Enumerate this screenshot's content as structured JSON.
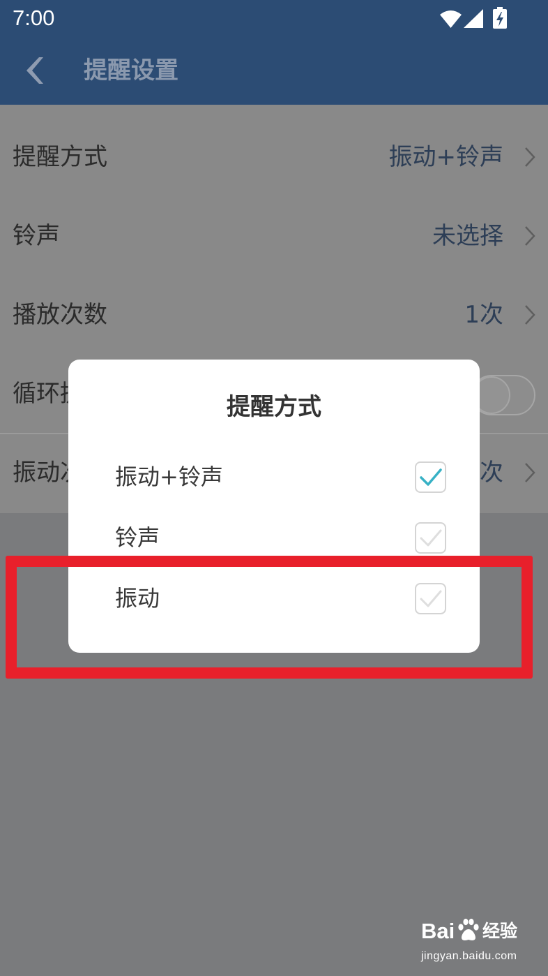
{
  "status_bar": {
    "time": "7:00",
    "icons": [
      "wifi-icon",
      "signal-icon",
      "battery-charging-icon"
    ]
  },
  "app_bar": {
    "back_icon": "back-chevron-icon",
    "title": "提醒设置"
  },
  "settings": {
    "rows": [
      {
        "label": "提醒方式",
        "value": "振动+铃声",
        "icon": "chevron-right-icon"
      },
      {
        "label": "铃声",
        "value": "未选择",
        "icon": "chevron-right-icon"
      },
      {
        "label": "播放次数",
        "value": "1次",
        "icon": "chevron-right-icon"
      },
      {
        "label": "循环提",
        "toggle_on": false
      },
      {
        "label": "振动次",
        "value": "次",
        "icon": "chevron-right-icon"
      }
    ]
  },
  "dialog": {
    "title": "提醒方式",
    "options": [
      {
        "label": "振动+铃声",
        "checked": true
      },
      {
        "label": "铃声",
        "checked": false
      },
      {
        "label": "振动",
        "checked": false
      }
    ],
    "check_icon": "checkmark-icon"
  },
  "watermark": {
    "brand_latin": "Bai",
    "brand_cn": "经验",
    "url": "jingyan.baidu.com",
    "icon": "baidu-paw-icon"
  },
  "colors": {
    "app_bar": "#2c4c74",
    "check_accent": "#37b1c5",
    "annotation_red": "#e8202b",
    "value_text": "#2d3e56"
  }
}
